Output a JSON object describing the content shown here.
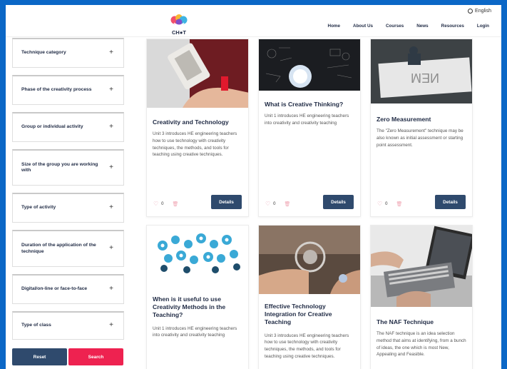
{
  "header": {
    "logo_text": "CH●T",
    "language": "English",
    "nav": [
      "Home",
      "About Us",
      "Courses",
      "News",
      "Resources",
      "Login"
    ]
  },
  "filters": [
    "Technique category",
    "Phase of the creativity process",
    "Group or individual activity",
    "Size of the group you are working with",
    "Type of activity",
    "Duration of the application of the technique",
    "Digital/on-line or face-to-face",
    "Type of class"
  ],
  "buttons": {
    "reset": "Reset",
    "search": "Search"
  },
  "cards": [
    {
      "title": "Creativity and Technology",
      "desc": "Unit 3 introduces HE engineering teachers how to use technology with creativity techniques, the methods, and tools for teaching using creative techniques.",
      "likes": "0",
      "details": "Details"
    },
    {
      "title": "What is Creative Thinking?",
      "desc": "Unit 1 introduces HE engineering teachers into creativity and creativity teaching",
      "likes": "0",
      "details": "Details"
    },
    {
      "title": "Zero Measurement",
      "desc": "The \"Zero Measurement\" technique may be also known as initial assessment or starting point assessment.",
      "likes": "0",
      "details": "Details"
    },
    {
      "title": "When is it useful to use Creativity Methods in the Teaching?",
      "desc": "Unit 1 introduces HE engineering teachers into creativity and creativity teaching"
    },
    {
      "title": "Effective Technology Integration for Creative Teaching",
      "desc": "Unit 3 introduces HE engineering teachers how to use technology with creativity techniques, the methods, and tools for teaching using creative techniques."
    },
    {
      "title": "The NAF Technique",
      "desc": "The NAF technique is an idea selection method that aims at identifying, from a bunch of ideas, the one which is most New, Appealing and Feasible."
    }
  ],
  "icons": {
    "globe": "globe-icon",
    "plus": "plus-icon",
    "heart": "heart-icon",
    "trash": "trash-icon"
  },
  "colors": {
    "frame": "#0b67c6",
    "primary": "#2f4a6d",
    "accent": "#ee2250"
  }
}
